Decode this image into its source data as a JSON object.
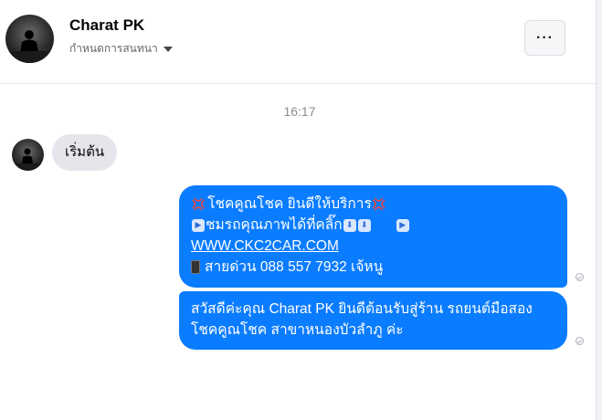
{
  "header": {
    "contact_name": "Charat PK",
    "conversation_setting": "กำหนดการสนทนา",
    "more_label": "···"
  },
  "timestamp": "16:17",
  "messages": {
    "incoming_1": "เริ่มต้น",
    "outgoing_1": {
      "line1": "โชคคูณโชค ยินดีให้บริการ",
      "line2": "ชมรถคุณภาพได้ที่คลิ๊ก",
      "link": "WWW.CKC2CAR.COM",
      "line4": "สายด่วน 088 557 7932 เจ้หนู"
    },
    "outgoing_2": {
      "line1": "สวัสดีค่ะคุณ Charat PK ยินดีต้อนรับสู่ร้าน รถยนต์มือสอง",
      "line2": "โชคคูณโชค สาขาหนองบัวลำภู ค่ะ"
    }
  },
  "icons": {
    "red_emoji": "💢",
    "play": "▶",
    "down": "⬇",
    "phone": "📱"
  },
  "colors": {
    "outgoing_bubble": "#0a7cff",
    "incoming_bubble": "#e4e6eb"
  }
}
